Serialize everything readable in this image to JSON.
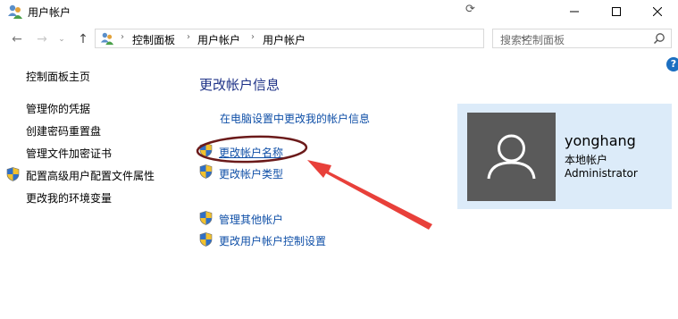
{
  "window": {
    "title": "用户帐户"
  },
  "navigation": {
    "breadcrumbs": [
      "控制面板",
      "用户帐户",
      "用户帐户"
    ],
    "search_placeholder": "搜索控制面板",
    "help_label": "?"
  },
  "sidebar": {
    "items": [
      {
        "label": "控制面板主页",
        "shield": false
      },
      {
        "label": "管理你的凭据",
        "shield": false
      },
      {
        "label": "创建密码重置盘",
        "shield": false
      },
      {
        "label": "管理文件加密证书",
        "shield": false
      },
      {
        "label": "配置高级用户配置文件属性",
        "shield": true
      },
      {
        "label": "更改我的环境变量",
        "shield": false
      }
    ]
  },
  "main": {
    "title": "更改帐户信息",
    "tasks": [
      {
        "label": "在电脑设置中更改我的帐户信息",
        "shield": false
      },
      {
        "label": "更改帐户名称",
        "shield": true
      },
      {
        "label": "更改帐户类型",
        "shield": true
      },
      {
        "label": "管理其他帐户",
        "shield": true
      },
      {
        "label": "更改用户帐户控制设置",
        "shield": true
      }
    ]
  },
  "user": {
    "name": "yonghang",
    "type": "本地帐户",
    "role": "Administrator"
  },
  "colors": {
    "link": "#0f4fa7",
    "title": "#1e3287",
    "card_bg": "#dcebf9",
    "annotation_ellipse": "#6b1a1a",
    "annotation_arrow": "#e8403a"
  }
}
